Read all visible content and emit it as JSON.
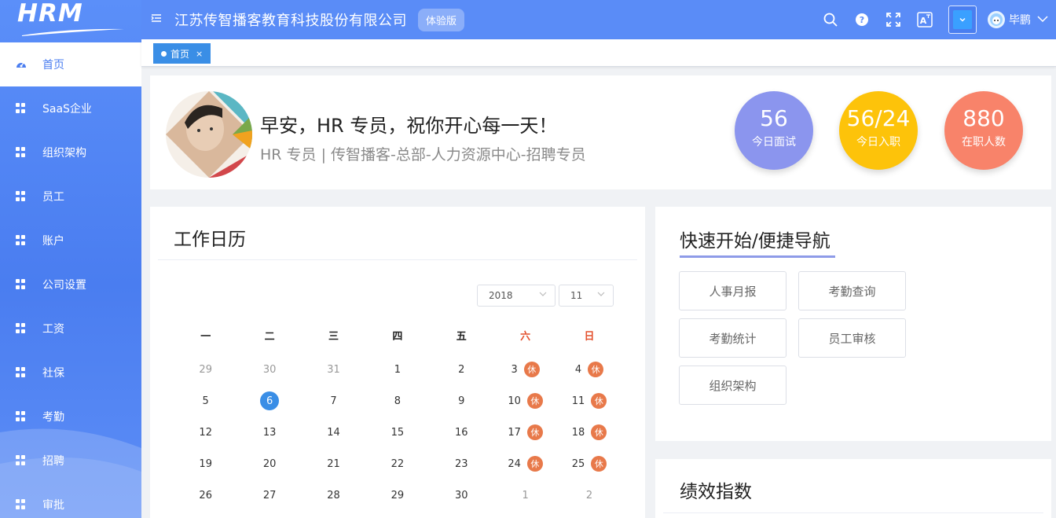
{
  "app": {
    "logo": "HRM"
  },
  "sidebar": {
    "items": [
      {
        "label": "首页"
      },
      {
        "label": "SaaS企业"
      },
      {
        "label": "组织架构"
      },
      {
        "label": "员工"
      },
      {
        "label": "账户"
      },
      {
        "label": "公司设置"
      },
      {
        "label": "工资"
      },
      {
        "label": "社保"
      },
      {
        "label": "考勤"
      },
      {
        "label": "招聘"
      },
      {
        "label": "审批"
      }
    ]
  },
  "header": {
    "company": "江苏传智播客教育科技股份有限公司",
    "trial_badge": "体验版",
    "user_name": "毕鹏"
  },
  "tags": [
    {
      "label": "首页",
      "close": "×"
    }
  ],
  "welcome": {
    "greeting": "早安，HR 专员，祝你开心每一天！",
    "subtitle": "HR 专员 | 传智播客-总部-人力资源中心-招聘专员",
    "stats": [
      {
        "value": "56",
        "label": "今日面试",
        "color": "#8b95ee"
      },
      {
        "value": "56/24",
        "label": "今日入职",
        "color": "#fdc30a"
      },
      {
        "value": "880",
        "label": "在职人数",
        "color": "#f8836a"
      }
    ]
  },
  "calendar": {
    "title": "工作日历",
    "year": "2018",
    "month": "11",
    "weekdays": [
      "一",
      "二",
      "三",
      "四",
      "五",
      "六",
      "日"
    ],
    "rest_label": "休",
    "weeks": [
      [
        {
          "d": "29",
          "o": true
        },
        {
          "d": "30",
          "o": true
        },
        {
          "d": "31",
          "o": true
        },
        {
          "d": "1"
        },
        {
          "d": "2"
        },
        {
          "d": "3",
          "r": true
        },
        {
          "d": "4",
          "r": true
        }
      ],
      [
        {
          "d": "5"
        },
        {
          "d": "6",
          "t": true
        },
        {
          "d": "7"
        },
        {
          "d": "8"
        },
        {
          "d": "9"
        },
        {
          "d": "10",
          "r": true
        },
        {
          "d": "11",
          "r": true
        }
      ],
      [
        {
          "d": "12"
        },
        {
          "d": "13"
        },
        {
          "d": "14"
        },
        {
          "d": "15"
        },
        {
          "d": "16"
        },
        {
          "d": "17",
          "r": true
        },
        {
          "d": "18",
          "r": true
        }
      ],
      [
        {
          "d": "19"
        },
        {
          "d": "20"
        },
        {
          "d": "21"
        },
        {
          "d": "22"
        },
        {
          "d": "23"
        },
        {
          "d": "24",
          "r": true
        },
        {
          "d": "25",
          "r": true
        }
      ],
      [
        {
          "d": "26"
        },
        {
          "d": "27"
        },
        {
          "d": "28"
        },
        {
          "d": "29"
        },
        {
          "d": "30"
        },
        {
          "d": "1",
          "o": true
        },
        {
          "d": "2",
          "o": true
        }
      ]
    ]
  },
  "quick_nav": {
    "title": "快速开始/便捷导航",
    "buttons": [
      "人事月报",
      "考勤查询",
      "考勤统计",
      "员工审核",
      "组织架构"
    ]
  },
  "performance": {
    "title": "绩效指数"
  }
}
